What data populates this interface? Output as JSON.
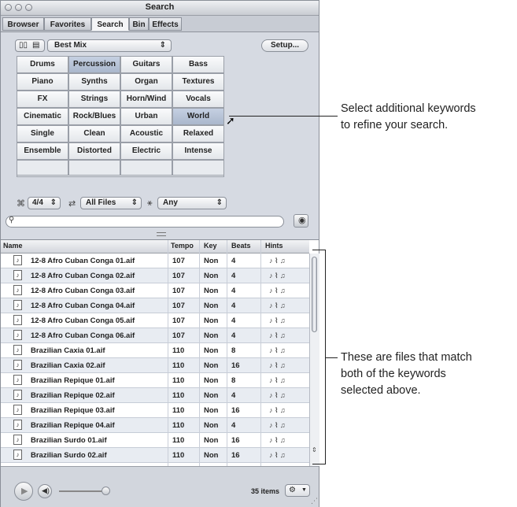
{
  "window": {
    "title": "Search"
  },
  "tabs": [
    "Browser",
    "Favorites",
    "Search",
    "Bin",
    "Effects"
  ],
  "toolbar": {
    "preset": "Best Mix",
    "setup_label": "Setup..."
  },
  "keywords": [
    [
      "Drums",
      "Percussion",
      "Guitars",
      "Bass"
    ],
    [
      "Piano",
      "Synths",
      "Organ",
      "Textures"
    ],
    [
      "FX",
      "Strings",
      "Horn/Wind",
      "Vocals"
    ],
    [
      "Cinematic",
      "Rock/Blues",
      "Urban",
      "World"
    ],
    [
      "Single",
      "Clean",
      "Acoustic",
      "Relaxed"
    ],
    [
      "Ensemble",
      "Distorted",
      "Electric",
      "Intense"
    ]
  ],
  "selected_keywords": [
    "Percussion",
    "World"
  ],
  "filters": {
    "time_signature": "4/4",
    "file_type": "All Files",
    "scale": "Any"
  },
  "search": {
    "placeholder": ""
  },
  "columns": [
    "Name",
    "Tempo",
    "Key",
    "Beats",
    "Hints"
  ],
  "rows": [
    {
      "name": "12-8 Afro Cuban Conga 01.aif",
      "tempo": "107",
      "key": "Non",
      "beats": "4"
    },
    {
      "name": "12-8 Afro Cuban Conga 02.aif",
      "tempo": "107",
      "key": "Non",
      "beats": "4"
    },
    {
      "name": "12-8 Afro Cuban Conga 03.aif",
      "tempo": "107",
      "key": "Non",
      "beats": "4"
    },
    {
      "name": "12-8 Afro Cuban Conga 04.aif",
      "tempo": "107",
      "key": "Non",
      "beats": "4"
    },
    {
      "name": "12-8 Afro Cuban Conga 05.aif",
      "tempo": "107",
      "key": "Non",
      "beats": "4"
    },
    {
      "name": "12-8 Afro Cuban Conga 06.aif",
      "tempo": "107",
      "key": "Non",
      "beats": "4"
    },
    {
      "name": "Brazilian Caxia 01.aif",
      "tempo": "110",
      "key": "Non",
      "beats": "8"
    },
    {
      "name": "Brazilian Caxia 02.aif",
      "tempo": "110",
      "key": "Non",
      "beats": "16"
    },
    {
      "name": "Brazilian Repique 01.aif",
      "tempo": "110",
      "key": "Non",
      "beats": "8"
    },
    {
      "name": "Brazilian Repique 02.aif",
      "tempo": "110",
      "key": "Non",
      "beats": "4"
    },
    {
      "name": "Brazilian Repique 03.aif",
      "tempo": "110",
      "key": "Non",
      "beats": "16"
    },
    {
      "name": "Brazilian Repique 04.aif",
      "tempo": "110",
      "key": "Non",
      "beats": "4"
    },
    {
      "name": "Brazilian Surdo 01.aif",
      "tempo": "110",
      "key": "Non",
      "beats": "16"
    },
    {
      "name": "Brazilian Surdo 02.aif",
      "tempo": "110",
      "key": "Non",
      "beats": "16"
    }
  ],
  "hints_glyph": "♪ ⌇ ♫",
  "footer": {
    "count": "35 items"
  },
  "callouts": {
    "top_line1": "Select additional keywords",
    "top_line2": "to refine your search.",
    "bottom_line1": "These are files that match",
    "bottom_line2": "both of the keywords",
    "bottom_line3": "selected above."
  },
  "colors": {
    "selected_cell": "#b3bfd3",
    "window_bg": "#d6dae2"
  }
}
